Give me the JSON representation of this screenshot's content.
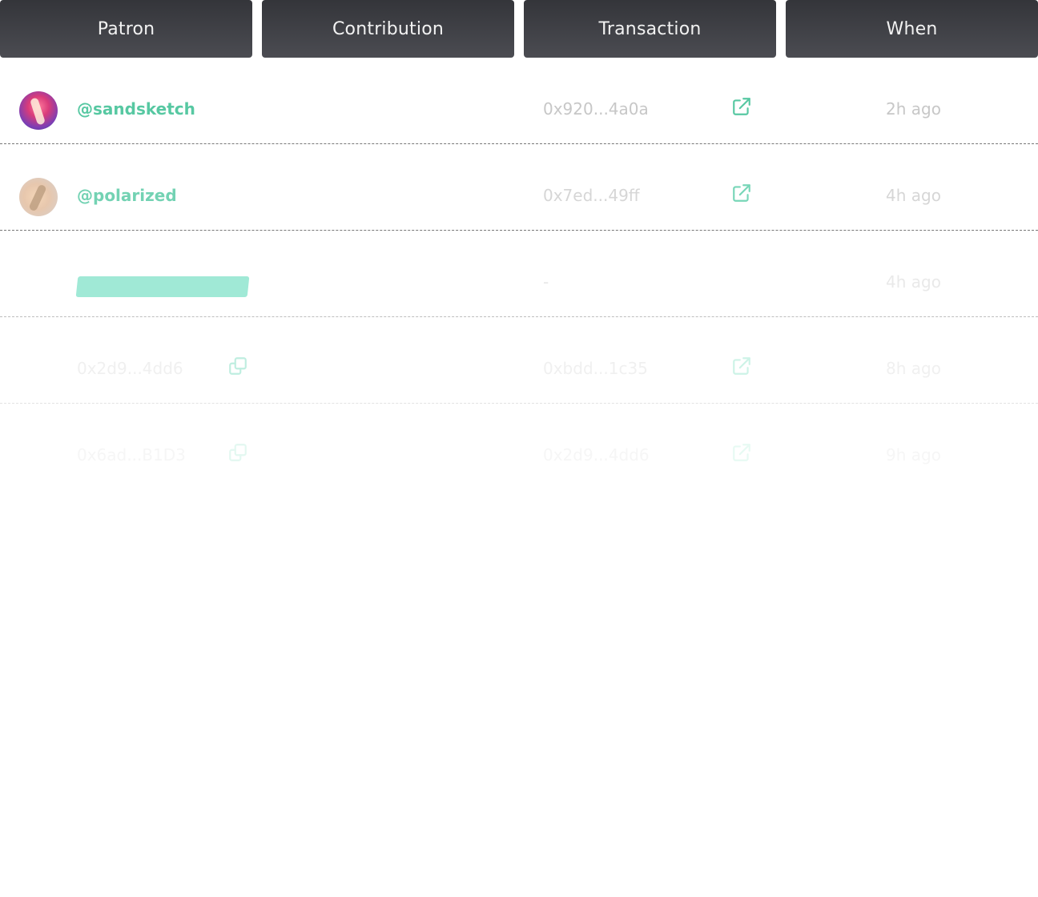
{
  "header": {
    "columns": [
      "Patron",
      "Contribution",
      "Transaction",
      "When"
    ]
  },
  "rows": [
    {
      "patron": "@sandsketch",
      "transaction": "0x920...4a0a",
      "when": "2h ago"
    },
    {
      "patron": "@polarized",
      "transaction": "0x7ed...49ff",
      "when": "4h ago"
    },
    {
      "patron": "",
      "transaction": "-",
      "when": "4h ago"
    },
    {
      "patron": "0x2d9...4dd6",
      "transaction": "0xbdd...1c35",
      "when": "8h ago"
    },
    {
      "patron": "0x6ad...B1D3",
      "transaction": "0x2d9...4dd6",
      "when": "9h ago"
    }
  ],
  "icons": {
    "external_link": "external-link-icon",
    "copy": "copy-icon"
  },
  "colors": {
    "accent_green": "#57c8a2",
    "redaction_mint": "#9be8d4",
    "header_dark": "#34353a"
  }
}
